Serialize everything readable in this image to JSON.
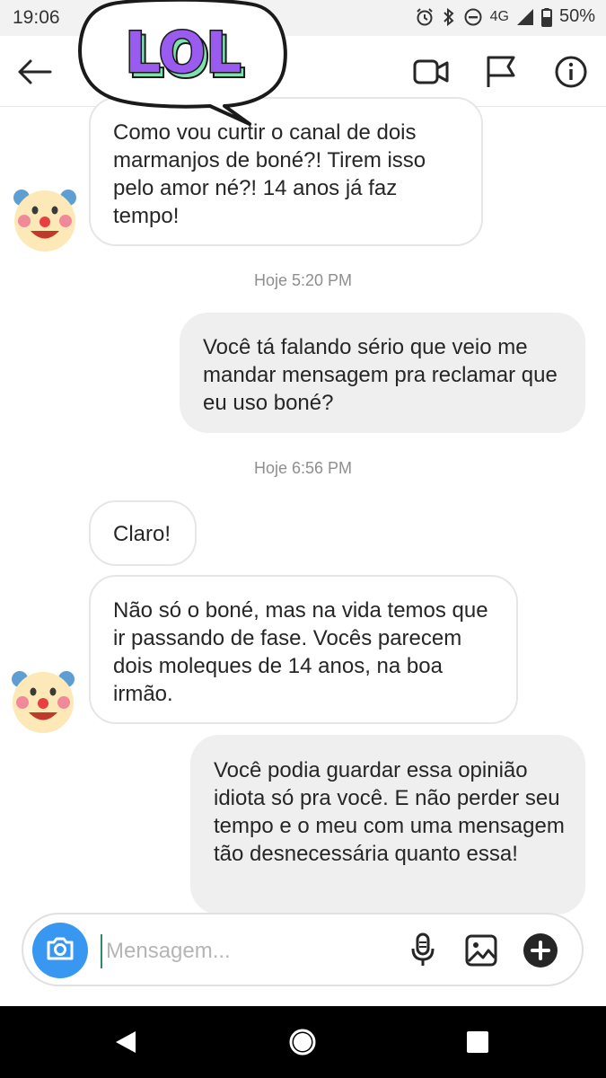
{
  "status_bar": {
    "time": "19:06",
    "network": "4G",
    "battery": "50%"
  },
  "sticker": {
    "text": "LOL"
  },
  "messages": [
    {
      "direction": "in",
      "text": "Como vou curtir o canal de dois marmanjos de boné?! Tirem isso pelo amor né?! 14 anos já faz tempo!"
    },
    {
      "direction": "out",
      "text": "Você tá falando sério que veio me mandar mensagem pra reclamar que eu uso boné?"
    },
    {
      "direction": "in",
      "text": "Claro!"
    },
    {
      "direction": "in",
      "text": "Não só o boné, mas na vida temos que ir passando de fase. Vocês parecem dois moleques de 14 anos, na boa irmão."
    },
    {
      "direction": "out",
      "text": "Você podia guardar essa opinião idiota só pra você. E não perder seu tempo e o meu com uma mensagem tão desnecessária quanto essa!"
    }
  ],
  "timestamps": [
    "Hoje 5:20 PM",
    "Hoje 6:56 PM"
  ],
  "composer": {
    "placeholder": "Mensagem..."
  },
  "colors": {
    "camera_button": "#3897f0",
    "incoming_bubble": "#ffffff",
    "outgoing_bubble": "#efefef",
    "timestamp": "#8e8e8e"
  },
  "icons": {
    "header": [
      "back-arrow-icon",
      "video-camera-icon",
      "flag-icon",
      "info-icon"
    ],
    "composer": [
      "camera-icon",
      "microphone-icon",
      "gallery-icon",
      "plus-icon"
    ],
    "navigation": [
      "back-triangle-icon",
      "home-circle-icon",
      "recents-square-icon"
    ]
  }
}
